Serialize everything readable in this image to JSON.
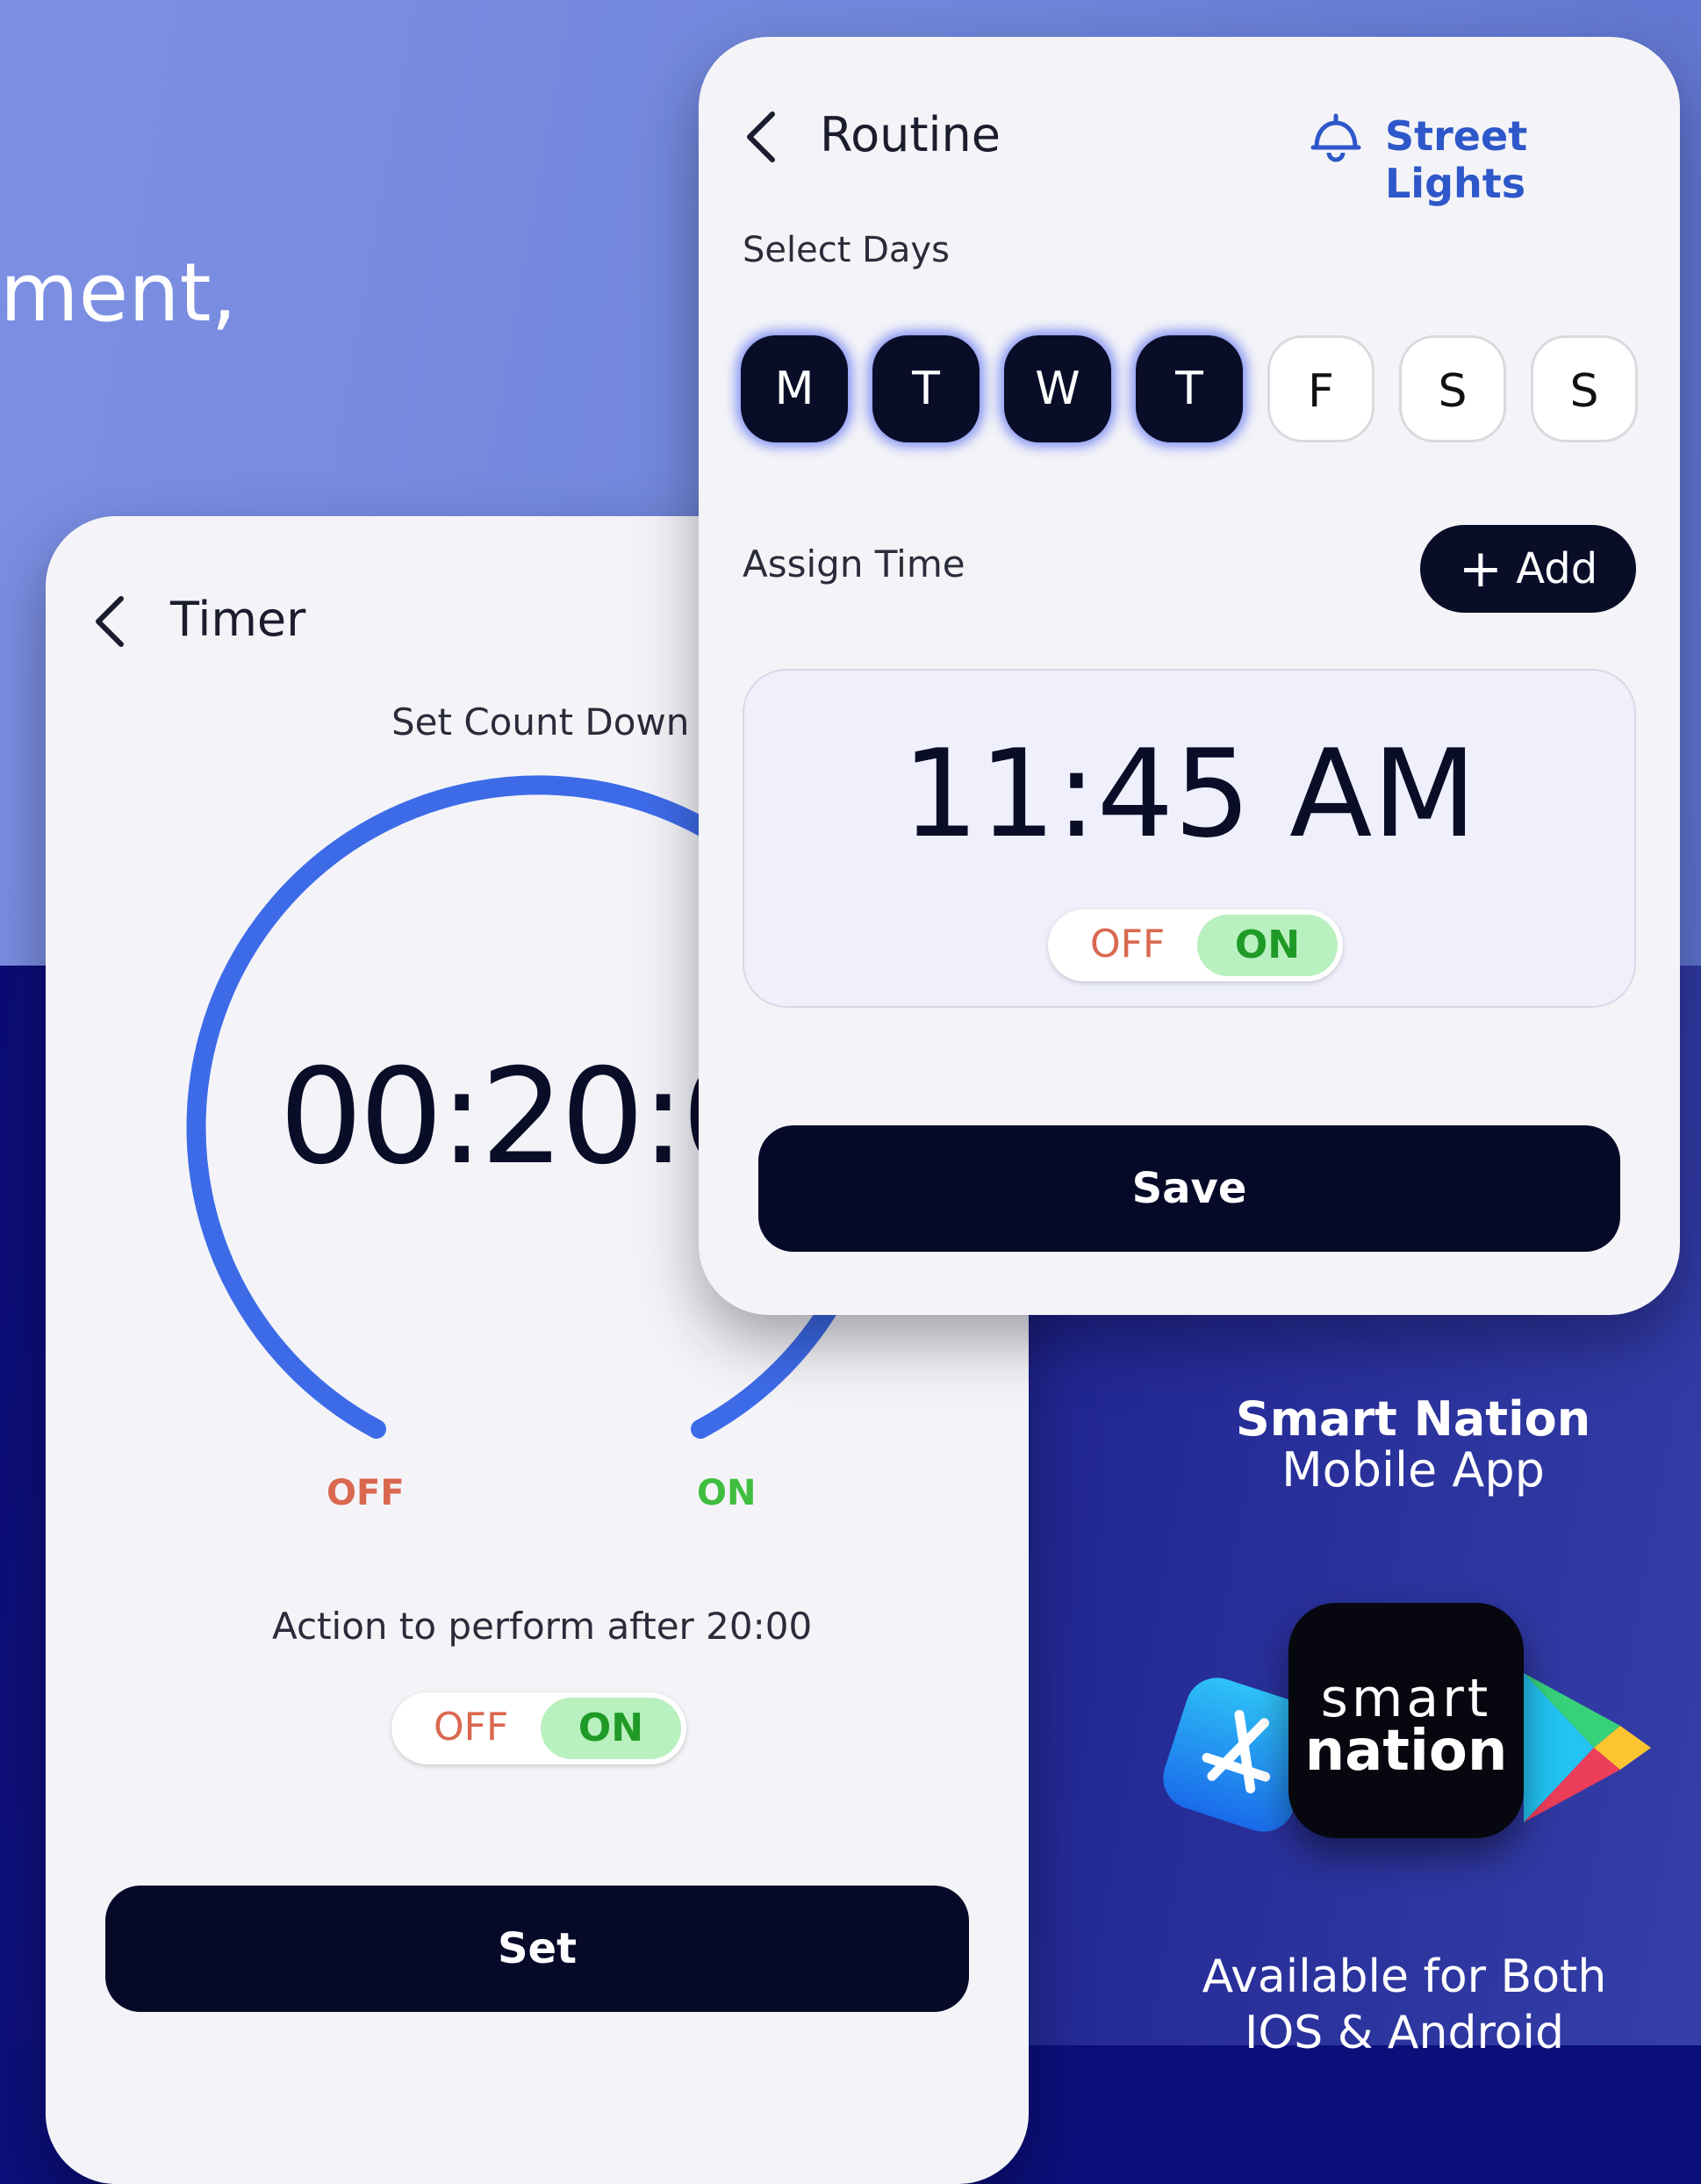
{
  "background": {
    "tagline": "ment,"
  },
  "timer": {
    "title": "Timer",
    "subtitle": "Set Count Down",
    "countdown": "00:20:0",
    "arc_off_label": "OFF",
    "arc_on_label": "ON",
    "action_text": "Action to perform after 20:00",
    "toggle": {
      "off": "OFF",
      "on": "ON",
      "selected": "ON"
    },
    "set_label": "Set"
  },
  "routine": {
    "title": "Routine",
    "device_label": "Street Lights",
    "select_days_label": "Select Days",
    "days": [
      {
        "label": "M",
        "selected": true
      },
      {
        "label": "T",
        "selected": true
      },
      {
        "label": "W",
        "selected": true
      },
      {
        "label": "T",
        "selected": true
      },
      {
        "label": "F",
        "selected": false
      },
      {
        "label": "S",
        "selected": false
      },
      {
        "label": "S",
        "selected": false
      }
    ],
    "assign_time_label": "Assign Time",
    "add_label": "Add",
    "time": "11:45 AM",
    "toggle": {
      "off": "OFF",
      "on": "ON",
      "selected": "ON"
    },
    "save_label": "Save"
  },
  "promo": {
    "app_name": "Smart Nation",
    "app_type": "Mobile App",
    "logo_line1": "smart",
    "logo_line2": "nation",
    "availability_line1": "Available for Both",
    "availability_line2": "IOS & Android"
  },
  "colors": {
    "accent_blue": "#3d6be8",
    "dark": "#060a28",
    "off_red": "#d9684f",
    "on_green": "#3fbd3f"
  }
}
